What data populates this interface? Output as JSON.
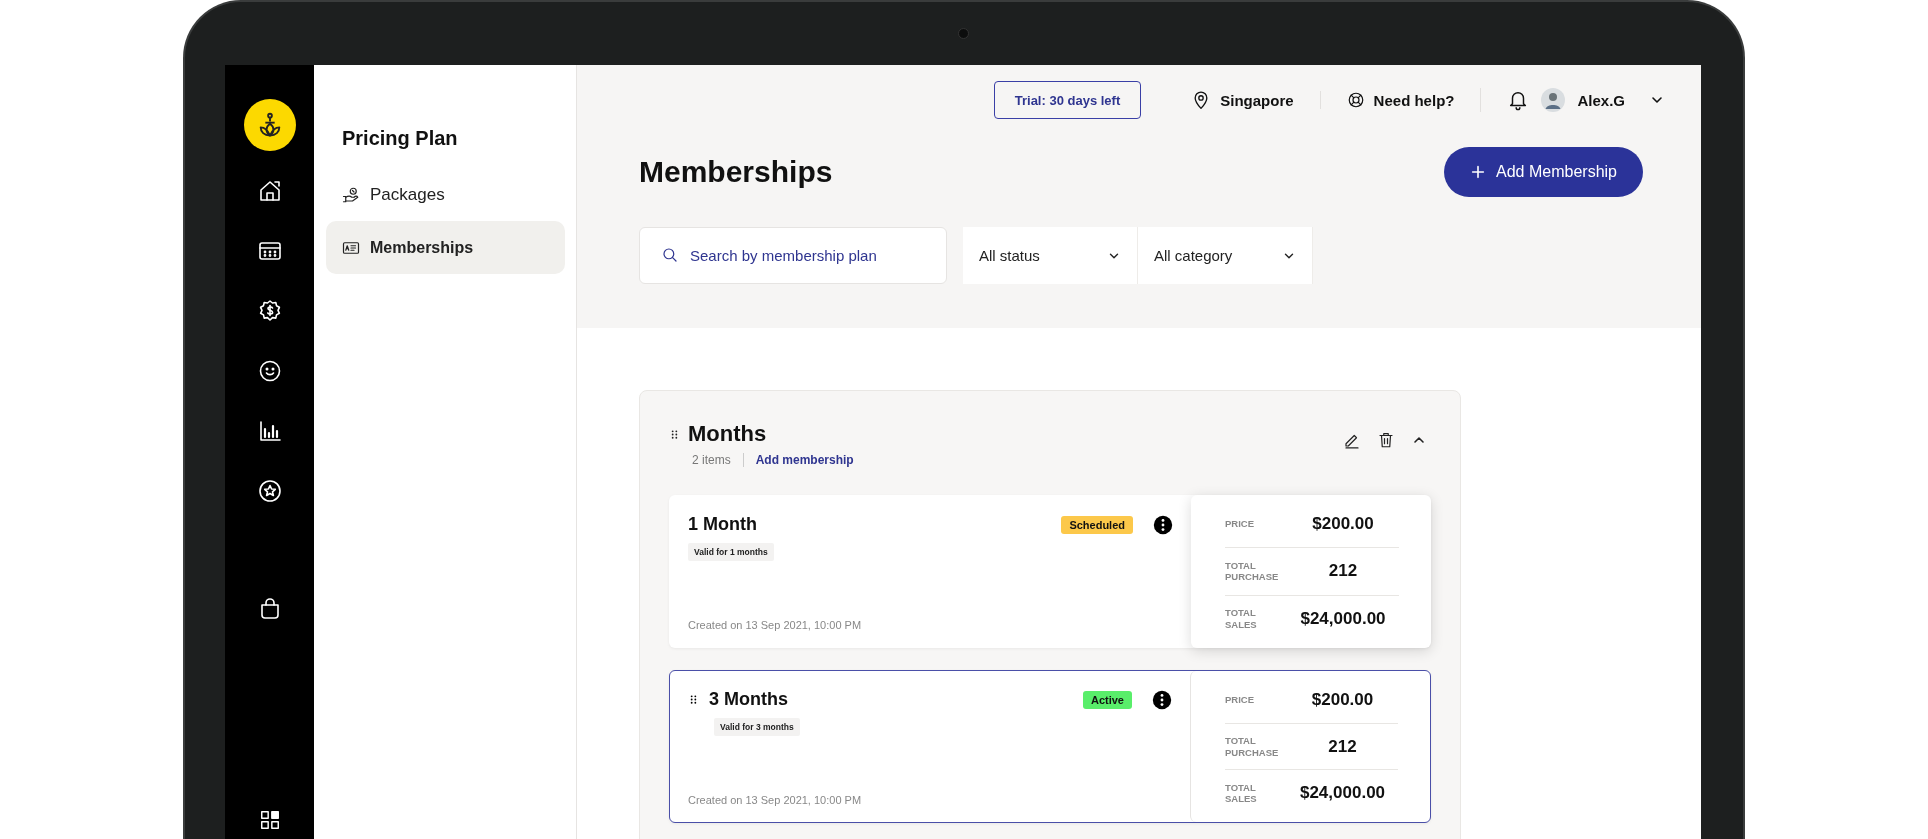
{
  "sidebar": {
    "title": "Pricing Plan",
    "items": [
      {
        "label": "Packages",
        "selected": false
      },
      {
        "label": "Memberships",
        "selected": true
      }
    ]
  },
  "topbar": {
    "trial": "Trial: 30 days left",
    "location": "Singapore",
    "help": "Need help?",
    "user": "Alex.G"
  },
  "page": {
    "title": "Memberships",
    "add_button": "Add Membership"
  },
  "filters": {
    "search_placeholder": "Search by membership plan",
    "status": "All status",
    "category": "All category"
  },
  "group": {
    "title": "Months",
    "count": "2 items",
    "add_link": "Add membership",
    "expanded": true,
    "memberships": [
      {
        "name": "1 Month",
        "status": "Scheduled",
        "color": "#fcc84a",
        "validity": "Valid for 1 months",
        "created": "Created on 13 Sep 2021, 10:00 PM",
        "selected": false,
        "stats": [
          {
            "label": "PRICE",
            "value": "$200.00"
          },
          {
            "label": "TOTAL PURCHASE",
            "value": "212"
          },
          {
            "label": "TOTAL SALES",
            "value": "$24,000.00"
          }
        ]
      },
      {
        "name": "3 Months",
        "status": "Active",
        "color": "#59ee6a",
        "validity": "Valid for 3 months",
        "created": "Created on 13 Sep 2021, 10:00 PM",
        "selected": true,
        "stats": [
          {
            "label": "PRICE",
            "value": "$200.00"
          },
          {
            "label": "TOTAL PURCHASE",
            "value": "212"
          },
          {
            "label": "TOTAL SALES",
            "value": "$24,000.00"
          }
        ]
      }
    ]
  }
}
